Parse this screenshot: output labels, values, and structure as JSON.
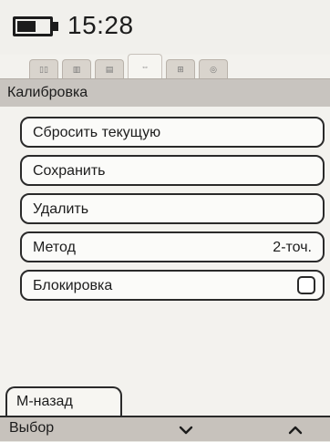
{
  "status": {
    "time": "15:28",
    "battery_icon": "battery-half-icon"
  },
  "tabs": {
    "items": [
      {
        "icon": "tab-icon-1"
      },
      {
        "icon": "tab-icon-2"
      },
      {
        "icon": "tab-icon-3"
      },
      {
        "icon": "tab-icon-calibration",
        "active": true
      },
      {
        "icon": "tab-icon-5"
      },
      {
        "icon": "tab-icon-6"
      }
    ]
  },
  "header": {
    "title": "Калибровка"
  },
  "menu": {
    "items": [
      {
        "label": "Сбросить текущую"
      },
      {
        "label": "Сохранить"
      },
      {
        "label": "Удалить"
      },
      {
        "label": "Метод",
        "value": "2-точ."
      },
      {
        "label": "Блокировка",
        "checked": false
      }
    ]
  },
  "footer": {
    "back_label": "M-назад",
    "select_label": "Выбор",
    "down_icon": "chevron-down-icon",
    "up_icon": "chevron-up-icon"
  },
  "colors": {
    "background": "#f3f2ee",
    "header": "#c8c4bf",
    "softbar": "#c7c2bc",
    "border": "#2a2a2a"
  }
}
